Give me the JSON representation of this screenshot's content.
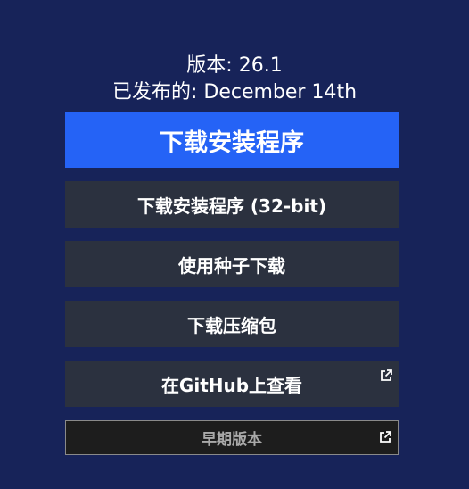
{
  "release": {
    "version_text": "版本: 26.1",
    "released_text": "已发布的: December 14th"
  },
  "buttons": {
    "download_installer": "下载安装程序",
    "download_installer_32": "下载安装程序 (32-bit)",
    "download_torrent": "使用种子下载",
    "download_archive": "下载压缩包",
    "view_github": "在GitHub上查看",
    "older_versions": "早期版本"
  },
  "colors": {
    "background": "#172359",
    "primary_button": "#2563f6",
    "secondary_button": "#2b313f",
    "older_button": "#1d1d1d"
  },
  "icons": {
    "github_external": "external-link-icon",
    "older_external": "external-link-icon"
  }
}
